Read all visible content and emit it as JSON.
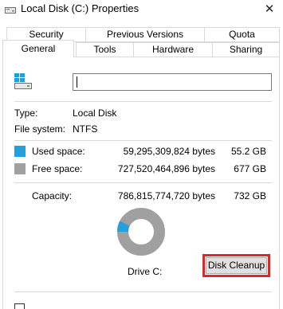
{
  "window": {
    "title": "Local Disk (C:) Properties",
    "close_glyph": "✕"
  },
  "tabs": {
    "row1": [
      "Security",
      "Previous Versions",
      "Quota"
    ],
    "row2": [
      "General",
      "Tools",
      "Hardware",
      "Sharing"
    ],
    "active": "General"
  },
  "general": {
    "drive_name_value": "",
    "type_label": "Type:",
    "type_value": "Local Disk",
    "fs_label": "File system:",
    "fs_value": "NTFS",
    "used_label": "Used space:",
    "used_bytes": "59,295,309,824 bytes",
    "used_size": "55.2 GB",
    "free_label": "Free space:",
    "free_bytes": "727,520,464,896 bytes",
    "free_size": "677 GB",
    "capacity_label": "Capacity:",
    "capacity_bytes": "786,815,774,720 bytes",
    "capacity_size": "732 GB",
    "drive_label": "Drive C:",
    "cleanup_button": "Disk Cleanup"
  },
  "usage": {
    "used_fraction": 0.0754,
    "used_color": "#26a0da",
    "free_color": "#a0a0a0"
  },
  "colors": {
    "tab_border": "#d9d9d9",
    "highlight": "#e0252b",
    "windows_blue": "#1ba1e2"
  },
  "icons": {
    "title": "drive-icon",
    "drive": "windows-drive-icon",
    "close": "close-icon"
  }
}
